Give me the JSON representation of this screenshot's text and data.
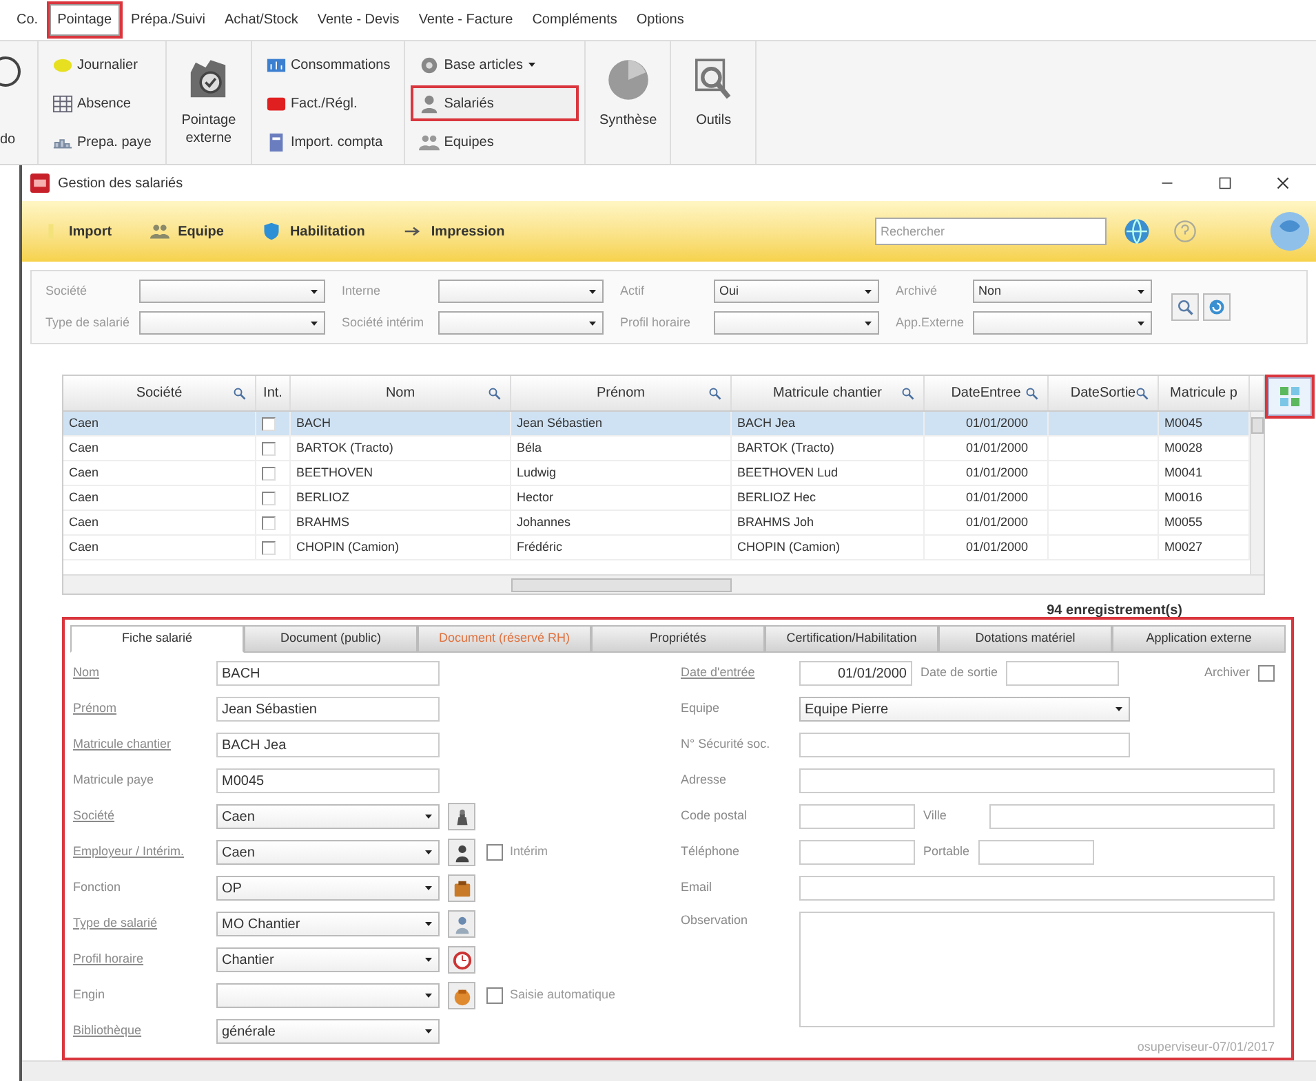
{
  "menu": [
    {
      "label": "Co.",
      "selected": false,
      "highlighted": false
    },
    {
      "label": "Pointage",
      "selected": true,
      "highlighted": true
    },
    {
      "label": "Prépa./Suivi",
      "selected": false,
      "highlighted": false
    },
    {
      "label": "Achat/Stock",
      "selected": false,
      "highlighted": false
    },
    {
      "label": "Vente - Devis",
      "selected": false,
      "highlighted": false
    },
    {
      "label": "Vente - Facture",
      "selected": false,
      "highlighted": false
    },
    {
      "label": "Compléments",
      "selected": false,
      "highlighted": false
    },
    {
      "label": "Options",
      "selected": false,
      "highlighted": false
    }
  ],
  "ribbon": {
    "leading_label": "do",
    "columns": [
      {
        "kind": "stack",
        "items": [
          {
            "label": "Journalier",
            "highlighted": false,
            "dropdown": false
          },
          {
            "label": "Absence",
            "highlighted": false,
            "dropdown": false
          },
          {
            "label": "Prepa. paye",
            "highlighted": false,
            "dropdown": false
          }
        ]
      },
      {
        "kind": "big",
        "label": "Pointage externe"
      },
      {
        "kind": "stack",
        "items": [
          {
            "label": "Consommations",
            "highlighted": false,
            "dropdown": false
          },
          {
            "label": "Fact./Régl.",
            "highlighted": false,
            "dropdown": false
          },
          {
            "label": "Import. compta",
            "highlighted": false,
            "dropdown": false
          }
        ]
      },
      {
        "kind": "stack",
        "items": [
          {
            "label": "Base articles",
            "highlighted": false,
            "dropdown": true
          },
          {
            "label": "Salariés",
            "highlighted": true,
            "dropdown": false
          },
          {
            "label": "Equipes",
            "highlighted": false,
            "dropdown": false
          }
        ]
      },
      {
        "kind": "big",
        "label": "Synthèse"
      },
      {
        "kind": "big",
        "label": "Outils"
      }
    ]
  },
  "window": {
    "title": "Gestion des salariés"
  },
  "toolbar": {
    "buttons": [
      "Import",
      "Equipe",
      "Habilitation",
      "Impression"
    ],
    "search": {
      "placeholder": "Rechercher"
    }
  },
  "filters": [
    {
      "label": "Société"
    },
    {
      "label": "Interne"
    },
    {
      "label": "Actif",
      "value": "Oui"
    },
    {
      "label": "Archivé",
      "value": "Non"
    },
    {
      "label": "Type de salarié"
    },
    {
      "label": "Société intérim"
    },
    {
      "label": "Profil horaire"
    },
    {
      "label": "App.Externe"
    }
  ],
  "grid": {
    "columns": [
      "Société",
      "Int.",
      "Nom",
      "Prénom",
      "Matricule chantier",
      "DateEntree",
      "DateSortie",
      "Matricule p"
    ],
    "rows": [
      {
        "selected": true,
        "interim": false,
        "societe": "Caen",
        "nom": "BACH",
        "prenom": "Jean Sébastien",
        "matricule_chantier": "BACH Jea",
        "date_entree": "01/01/2000",
        "matricule_paye": "M0045"
      },
      {
        "selected": false,
        "interim": false,
        "societe": "Caen",
        "nom": "BARTOK (Tracto)",
        "prenom": "Béla",
        "matricule_chantier": "BARTOK (Tracto)",
        "date_entree": "01/01/2000",
        "matricule_paye": "M0028"
      },
      {
        "selected": false,
        "interim": false,
        "societe": "Caen",
        "nom": "BEETHOVEN",
        "prenom": "Ludwig",
        "matricule_chantier": "BEETHOVEN Lud",
        "date_entree": "01/01/2000",
        "matricule_paye": "M0041"
      },
      {
        "selected": false,
        "interim": false,
        "societe": "Caen",
        "nom": "BERLIOZ",
        "prenom": "Hector",
        "matricule_chantier": "BERLIOZ Hec",
        "date_entree": "01/01/2000",
        "matricule_paye": "M0016"
      },
      {
        "selected": false,
        "interim": false,
        "societe": "Caen",
        "nom": "BRAHMS",
        "prenom": "Johannes",
        "matricule_chantier": "BRAHMS Joh",
        "date_entree": "01/01/2000",
        "matricule_paye": "M0055"
      },
      {
        "selected": false,
        "interim": false,
        "societe": "Caen",
        "nom": "CHOPIN (Camion)",
        "prenom": "Frédéric",
        "matricule_chantier": "CHOPIN (Camion)",
        "date_entree": "01/01/2000",
        "matricule_paye": "M0027"
      }
    ],
    "count": "94 enregistrement(s)",
    "column_chooser": {
      "highlighted": true
    }
  },
  "form": {
    "highlighted": true,
    "tabs": [
      {
        "label": "Fiche salarié",
        "selected": true,
        "restricted": false
      },
      {
        "label": "Document (public)",
        "selected": false,
        "restricted": false
      },
      {
        "label": "Document (réservé RH)",
        "selected": false,
        "restricted": true
      },
      {
        "label": "Propriétés",
        "selected": false,
        "restricted": false
      },
      {
        "label": "Certification/Habilitation",
        "selected": false,
        "restricted": false
      },
      {
        "label": "Dotations matériel",
        "selected": false,
        "restricted": false
      },
      {
        "label": "Application externe",
        "selected": false,
        "restricted": false
      }
    ],
    "left": [
      {
        "label": "Nom",
        "link": true,
        "kind": "text",
        "value": "BACH"
      },
      {
        "label": "Prénom",
        "link": true,
        "kind": "text",
        "value": "Jean Sébastien"
      },
      {
        "label": "Matricule chantier",
        "link": true,
        "kind": "text",
        "value": "BACH Jea"
      },
      {
        "label": "Matricule paye",
        "link": false,
        "kind": "text",
        "value": "M0045"
      },
      {
        "label": "Société",
        "link": true,
        "kind": "select",
        "value": "Caen",
        "action": true
      },
      {
        "label": "Employeur / Intérim.",
        "link": true,
        "kind": "select",
        "value": "Caen",
        "action": true,
        "checkbox": {
          "label": "Intérim",
          "checked": false
        }
      },
      {
        "label": "Fonction",
        "link": false,
        "kind": "select",
        "value": "OP",
        "action": true
      },
      {
        "label": "Type de salarié",
        "link": true,
        "kind": "select",
        "value": "MO Chantier",
        "action": true
      },
      {
        "label": "Profil horaire",
        "link": true,
        "kind": "select",
        "value": "Chantier",
        "action": true
      },
      {
        "label": "Engin",
        "link": false,
        "kind": "select",
        "action": true,
        "checkbox": {
          "label": "Saisie automatique",
          "checked": false
        }
      },
      {
        "label": "Bibliothèque",
        "link": true,
        "kind": "select",
        "value": "générale",
        "action": false
      }
    ],
    "right": [
      [
        {
          "label": "Date d'entrée",
          "link": true,
          "kind": "date",
          "value": "01/01/2000"
        },
        {
          "label": "Date de sortie",
          "link": false,
          "kind": "date"
        },
        {
          "label": "Archiver",
          "link": false,
          "kind": "checkbox",
          "checked": false
        }
      ],
      [
        {
          "label": "Equipe",
          "link": false,
          "kind": "select",
          "value": "Equipe Pierre"
        }
      ],
      [
        {
          "label": "N° Sécurité soc.",
          "link": false,
          "kind": "text-medium"
        }
      ],
      [
        {
          "label": "Adresse",
          "link": false,
          "kind": "text"
        }
      ],
      [
        {
          "label": "Code postal",
          "link": false,
          "kind": "text-short"
        },
        {
          "label": "Ville",
          "link": false,
          "kind": "text"
        }
      ],
      [
        {
          "label": "Téléphone",
          "link": false,
          "kind": "text-short"
        },
        {
          "label": "Portable",
          "link": false,
          "kind": "text-short"
        }
      ],
      [
        {
          "label": "Email",
          "link": false,
          "kind": "text"
        }
      ],
      [
        {
          "label": "Observation",
          "link": false,
          "kind": "textarea"
        }
      ]
    ],
    "footer": "osuperviseur-07/01/2017"
  }
}
